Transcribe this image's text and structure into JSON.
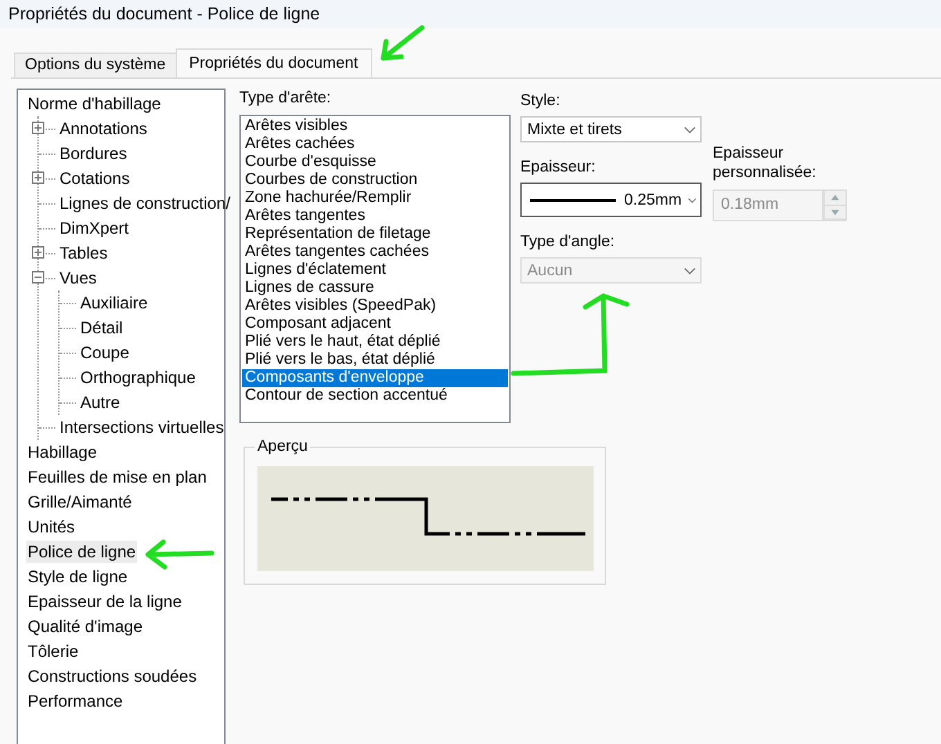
{
  "window": {
    "title": "Propriétés du document - Police de ligne"
  },
  "tabs": [
    {
      "label": "Options du système",
      "selected": false
    },
    {
      "label": "Propriétés du document",
      "selected": true
    }
  ],
  "tree": [
    {
      "label": "Norme d'habillage",
      "selected": false,
      "children": [
        {
          "label": "Annotations",
          "selected": false,
          "expanded": false
        },
        {
          "label": "Bordures",
          "selected": false
        },
        {
          "label": "Cotations",
          "selected": false,
          "expanded": false
        },
        {
          "label": "Lignes de construction/",
          "selected": false
        },
        {
          "label": "DimXpert",
          "selected": false
        },
        {
          "label": "Tables",
          "selected": false,
          "expanded": false
        },
        {
          "label": "Vues",
          "selected": false,
          "expanded": true,
          "children": [
            {
              "label": "Auxiliaire",
              "selected": false
            },
            {
              "label": "Détail",
              "selected": false
            },
            {
              "label": "Coupe",
              "selected": false
            },
            {
              "label": "Orthographique",
              "selected": false
            },
            {
              "label": "Autre",
              "selected": false
            }
          ]
        },
        {
          "label": "Intersections virtuelles",
          "selected": false
        }
      ]
    },
    {
      "label": "Habillage",
      "selected": false
    },
    {
      "label": "Feuilles de mise en plan",
      "selected": false
    },
    {
      "label": "Grille/Aimanté",
      "selected": false
    },
    {
      "label": "Unités",
      "selected": false
    },
    {
      "label": "Police de ligne",
      "selected": true
    },
    {
      "label": "Style de ligne",
      "selected": false
    },
    {
      "label": "Epaisseur de la ligne",
      "selected": false
    },
    {
      "label": "Qualité d'image",
      "selected": false
    },
    {
      "label": "Tôlerie",
      "selected": false
    },
    {
      "label": "Constructions soudées",
      "selected": false
    },
    {
      "label": "Performance",
      "selected": false
    }
  ],
  "edge_type": {
    "label": "Type d'arête:",
    "items": [
      {
        "label": "Arêtes visibles",
        "selected": false
      },
      {
        "label": "Arêtes cachées",
        "selected": false
      },
      {
        "label": "Courbe d'esquisse",
        "selected": false
      },
      {
        "label": "Courbes de construction",
        "selected": false
      },
      {
        "label": "Zone hachurée/Remplir",
        "selected": false
      },
      {
        "label": "Arêtes tangentes",
        "selected": false
      },
      {
        "label": "Représentation de filetage",
        "selected": false
      },
      {
        "label": "Arêtes tangentes cachées",
        "selected": false
      },
      {
        "label": "Lignes d'éclatement",
        "selected": false
      },
      {
        "label": "Lignes de cassure",
        "selected": false
      },
      {
        "label": "Arêtes visibles (SpeedPak)",
        "selected": false
      },
      {
        "label": "Composant adjacent",
        "selected": false
      },
      {
        "label": "Plié vers le haut, état déplié",
        "selected": false
      },
      {
        "label": "Plié vers le bas, état déplié",
        "selected": false
      },
      {
        "label": "Composants d'enveloppe",
        "selected": true
      },
      {
        "label": "Contour de section accentué",
        "selected": false
      }
    ]
  },
  "style": {
    "label": "Style:",
    "value": "Mixte et tirets",
    "disabled": false
  },
  "thickness": {
    "label": "Epaisseur:",
    "value": "0.25mm",
    "disabled": false
  },
  "custom_thickness": {
    "label": "Epaisseur personnalisée:",
    "value": "0.18mm",
    "disabled": true
  },
  "corner_type": {
    "label": "Type d'angle:",
    "value": "Aucun",
    "disabled": true
  },
  "preview": {
    "label": "Aperçu"
  }
}
